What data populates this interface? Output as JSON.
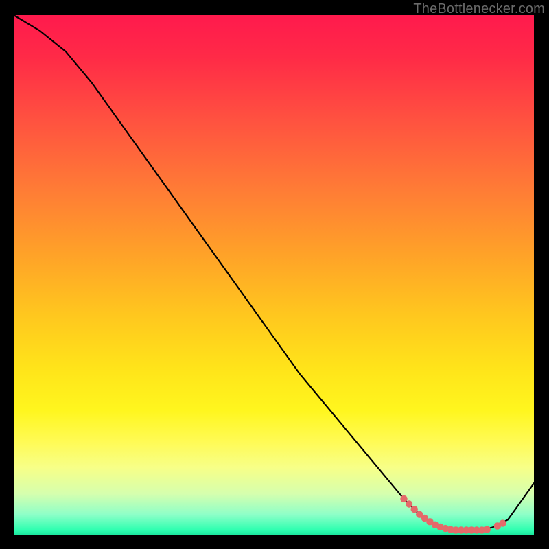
{
  "watermark": "TheBottlenecker.com",
  "colors": {
    "frame_bg": "#000000",
    "grad_top": "#ff1a4d",
    "grad_mid": "#ffe41a",
    "grad_bottom": "#18e29b",
    "curve_stroke": "#000000",
    "marker_fill": "#e46a6a"
  },
  "chart_data": {
    "type": "line",
    "title": "",
    "xlabel": "",
    "ylabel": "",
    "xlim": [
      0,
      100
    ],
    "ylim": [
      0,
      100
    ],
    "series": [
      {
        "name": "bottleneck-curve",
        "x": [
          0,
          5,
          10,
          15,
          20,
          25,
          30,
          35,
          40,
          45,
          50,
          55,
          60,
          65,
          70,
          75,
          78,
          80,
          82,
          84,
          86,
          88,
          90,
          92,
          95,
          100
        ],
        "y": [
          100,
          97,
          93,
          87,
          80,
          73,
          66,
          59,
          52,
          45,
          38,
          31,
          25,
          19,
          13,
          7,
          4,
          2.5,
          1.5,
          1,
          1,
          1,
          1,
          1.5,
          3,
          10
        ]
      }
    ],
    "markers": {
      "name": "highlight-dots",
      "x": [
        75,
        76,
        77,
        78,
        79,
        80,
        81,
        82,
        83,
        84,
        85,
        86,
        87,
        88,
        89,
        90,
        91,
        93,
        94
      ],
      "y": [
        7,
        6,
        5,
        4,
        3.3,
        2.6,
        2,
        1.6,
        1.3,
        1.1,
        1,
        1,
        1,
        1,
        1,
        1,
        1.1,
        1.8,
        2.3
      ]
    }
  }
}
